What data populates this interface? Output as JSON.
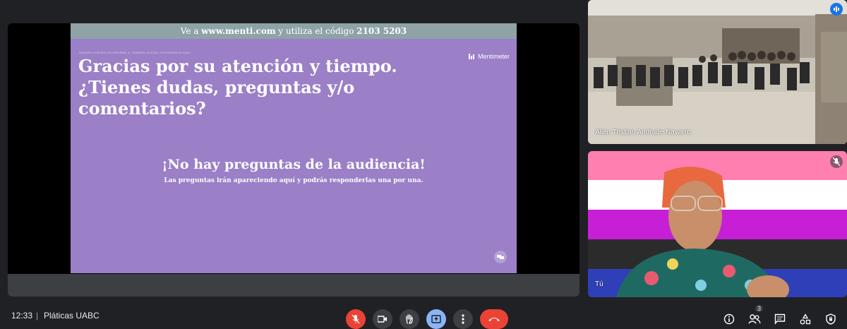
{
  "presentation": {
    "banner_prefix": "Ve a ",
    "banner_url": "www.menti.com",
    "banner_mid": " y utiliza el código ",
    "banner_code": "2103 5203",
    "small_caption": "TAMBIÉN PUEDES ESCRIBIRME A: TAMBIEN PUEDES ESCRIBIRNOS AQUÍ",
    "brand": "Mentimeter",
    "title": "Gracias por su atención y tiempo. ¿Tienes dudas, preguntas y/o comentarios?",
    "empty_title": "¡No hay preguntas de la audiencia!",
    "empty_subtitle": "Las preguntas irán apareciendo aquí y podrás responderlas una por una."
  },
  "participants": [
    {
      "name": "Allen Tristian Andrade Navarro",
      "icon": "speaking-indicator-icon"
    },
    {
      "name": "Tú",
      "icon": "mic-off-icon"
    }
  ],
  "flag_colors": [
    "#ff7fb0",
    "#ffffff",
    "#c71fd6",
    "#2b2b2b",
    "#2f3fb8"
  ],
  "bottom_bar": {
    "time": "12:33",
    "separator": "|",
    "meeting_name": "Pláticas UABC",
    "participant_count": "3",
    "controls": [
      "mic-off-icon",
      "camera-icon",
      "raise-hand-icon",
      "present-icon",
      "more-options-icon",
      "hang-up-icon"
    ],
    "right_icons": [
      "info-icon",
      "people-icon",
      "chat-icon",
      "activities-icon",
      "host-controls-icon"
    ]
  },
  "colors": {
    "slide_bg": "#9b7fc7",
    "slide_banner": "#8fa3a6",
    "red": "#ea4335",
    "blue": "#8ab4f8",
    "bar_bg": "#202124"
  }
}
